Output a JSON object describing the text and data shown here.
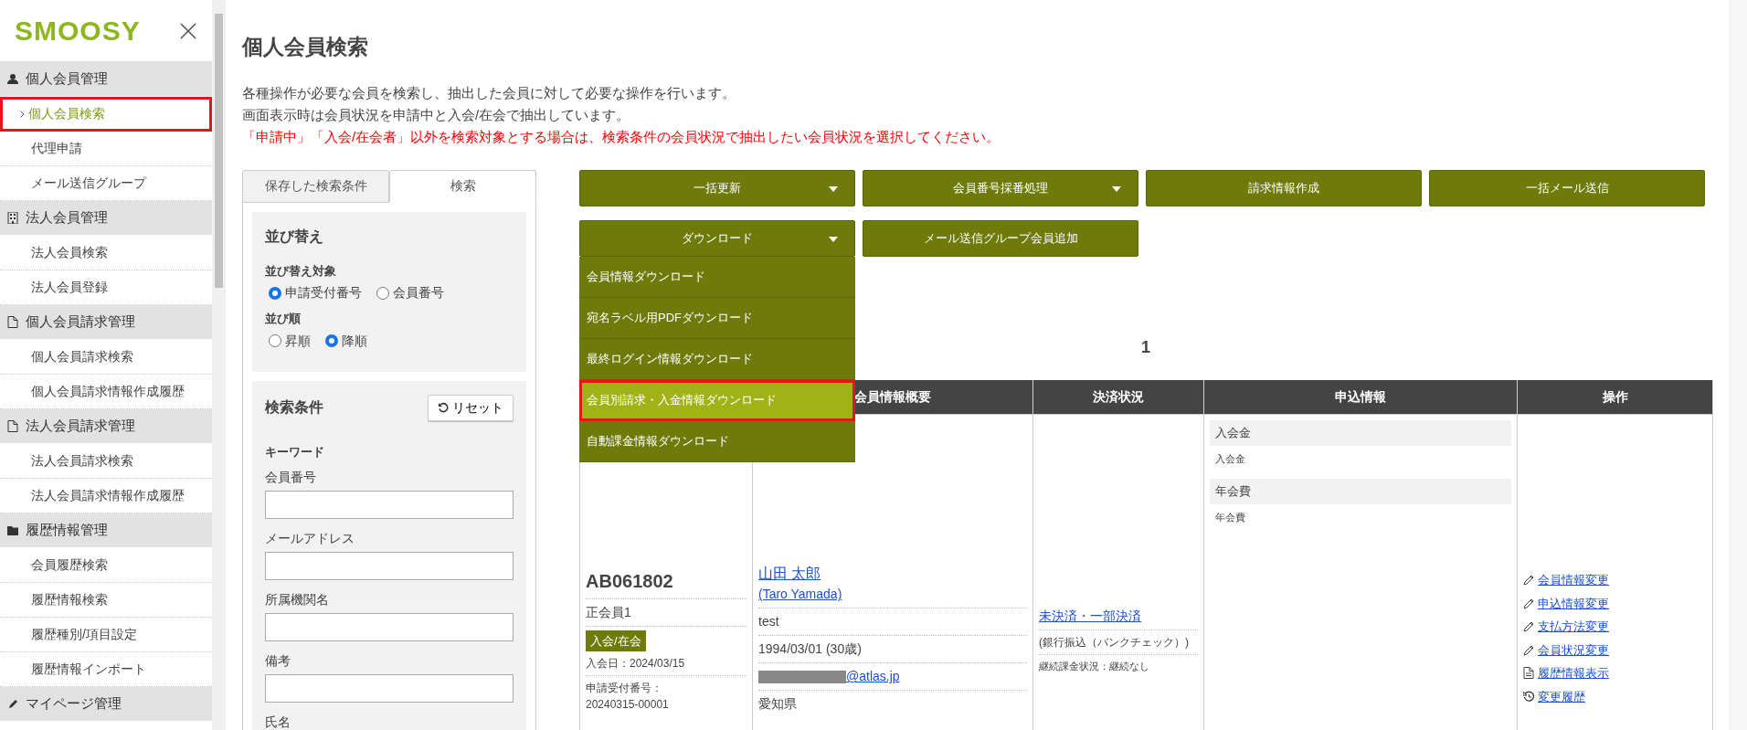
{
  "sidebar": {
    "logo": "SMOOSY",
    "groups": [
      {
        "label": "個人会員管理",
        "items": [
          {
            "label": "個人会員検索",
            "selected": true,
            "highlighted": true
          },
          {
            "label": "代理申請",
            "selected": false,
            "highlighted": false
          },
          {
            "label": "メール送信グループ",
            "selected": false,
            "highlighted": false
          }
        ]
      },
      {
        "label": "法人会員管理",
        "items": [
          {
            "label": "法人会員検索",
            "selected": false,
            "highlighted": false
          },
          {
            "label": "法人会員登録",
            "selected": false,
            "highlighted": false
          }
        ]
      },
      {
        "label": "個人会員請求管理",
        "items": [
          {
            "label": "個人会員請求検索",
            "selected": false,
            "highlighted": false
          },
          {
            "label": "個人会員請求情報作成履歴",
            "selected": false,
            "highlighted": false
          }
        ]
      },
      {
        "label": "法人会員請求管理",
        "items": [
          {
            "label": "法人会員請求検索",
            "selected": false,
            "highlighted": false
          },
          {
            "label": "法人会員請求情報作成履歴",
            "selected": false,
            "highlighted": false
          }
        ]
      },
      {
        "label": "履歴情報管理",
        "items": [
          {
            "label": "会員履歴検索",
            "selected": false,
            "highlighted": false
          },
          {
            "label": "履歴情報検索",
            "selected": false,
            "highlighted": false
          },
          {
            "label": "履歴種別/項目設定",
            "selected": false,
            "highlighted": false
          },
          {
            "label": "履歴情報インポート",
            "selected": false,
            "highlighted": false
          }
        ]
      },
      {
        "label": "マイページ管理"
      }
    ]
  },
  "page": {
    "title": "個人会員検索",
    "notes": [
      {
        "text": "各種操作が必要な会員を検索し、抽出した会員に対して必要な操作を行います。",
        "kind": "info"
      },
      {
        "text": "画面表示時は会員状況を申請中と入会/在会で抽出しています。",
        "kind": "info"
      },
      {
        "text": "「申請中」「入会/在会者」以外を検索対象とする場合は、検索条件の会員状況で抽出したい会員状況を選択してください。",
        "kind": "warning"
      }
    ]
  },
  "tabs": [
    {
      "label": "保存した検索条件",
      "selected": false
    },
    {
      "label": "検索",
      "selected": true
    }
  ],
  "sort_panel": {
    "title": "並び替え",
    "groups": [
      {
        "label": "並び替え対象",
        "options": [
          {
            "label": "申請受付番号",
            "selected": true
          },
          {
            "label": "会員番号",
            "selected": false
          }
        ]
      },
      {
        "label": "並び順",
        "options": [
          {
            "label": "昇順",
            "selected": false
          },
          {
            "label": "降順",
            "selected": true
          }
        ]
      }
    ]
  },
  "search_panel": {
    "title": "検索条件",
    "reset_button": "リセット",
    "section": "キーワード",
    "fields": [
      {
        "label": "会員番号"
      },
      {
        "label": "メールアドレス"
      },
      {
        "label": "所属機関名"
      },
      {
        "label": "備考"
      },
      {
        "label": "氏名"
      }
    ]
  },
  "actions": [
    {
      "label": "一括更新",
      "dropdown": true,
      "expanded": false
    },
    {
      "label": "会員番号採番処理",
      "dropdown": true,
      "expanded": false
    },
    {
      "label": "請求情報作成",
      "dropdown": false,
      "expanded": false
    },
    {
      "label": "一括メール送信",
      "dropdown": false,
      "expanded": false
    },
    {
      "label": "ダウンロード",
      "dropdown": true,
      "expanded": true
    },
    {
      "label": "メール送信グループ会員追加",
      "dropdown": false,
      "expanded": false
    }
  ],
  "download_menu": [
    {
      "label": "会員情報ダウンロード",
      "highlighted": false
    },
    {
      "label": "宛名ラベル用PDFダウンロード",
      "highlighted": false
    },
    {
      "label": "最終ログイン情報ダウンロード",
      "highlighted": false
    },
    {
      "label": "会員別請求・入金情報ダウンロード",
      "highlighted": true
    },
    {
      "label": "自動課金情報ダウンロード",
      "highlighted": false
    }
  ],
  "pagination": "1",
  "table": {
    "columns": [
      {
        "label": "会員情報概要"
      },
      {
        "label": "決済状況"
      },
      {
        "label": "申込情報"
      },
      {
        "label": "操作"
      }
    ],
    "rows": [
      {
        "member": {
          "id": "AB061802",
          "type": "正会員1",
          "status": "入会/在会",
          "joined": "入会日：2024/03/15",
          "application_label": "申請受付番号：",
          "application_no": "20240315-00001"
        },
        "info": {
          "name": "山田 太郎",
          "name_en": "(Taro Yamada)",
          "note": "test",
          "birth": "1994/03/01 (30歳)",
          "email": "@atlas.jp",
          "email_redacted": true,
          "prefecture": "愛知県"
        },
        "payment": {
          "status": "未決済・一部決済",
          "method": "(銀行振込（バンクチェック）)",
          "recurring": "継続課金状況：継続なし"
        },
        "application": [
          {
            "heading": "入会金",
            "text": "入会金"
          },
          {
            "heading": "年会費",
            "text": "年会費"
          }
        ],
        "operations": [
          {
            "label": "会員情報変更",
            "kind": "edit"
          },
          {
            "label": "申込情報変更",
            "kind": "edit"
          },
          {
            "label": "支払方法変更",
            "kind": "edit"
          },
          {
            "label": "会員状況変更",
            "kind": "edit"
          },
          {
            "label": "履歴情報表示",
            "kind": "document"
          },
          {
            "label": "変更履歴",
            "kind": "history"
          }
        ]
      }
    ]
  }
}
